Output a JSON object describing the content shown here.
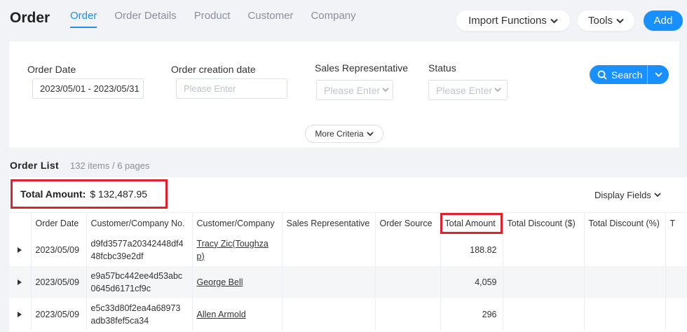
{
  "header": {
    "title": "Order",
    "tabs": [
      "Order",
      "Order Details",
      "Product",
      "Customer",
      "Company"
    ],
    "import_label": "Import Functions",
    "tools_label": "Tools",
    "add_label": "Add"
  },
  "filters": {
    "order_date_label": "Order Date",
    "order_date_value": "2023/05/01 - 2023/05/31",
    "creation_date_label": "Order creation date",
    "creation_date_placeholder": "Please Enter",
    "sales_rep_label": "Sales Representative",
    "sales_rep_placeholder": "Please Enter",
    "status_label": "Status",
    "status_placeholder": "Please Enter",
    "search_label": "Search",
    "more_label": "More Criteria"
  },
  "list": {
    "title": "Order List",
    "count": "132 items / 6 pages",
    "total_label": "Total Amount:",
    "total_value": "$ 132,487.95",
    "display_fields_label": "Display Fields",
    "columns": [
      "Order Date",
      "Customer/Company No.",
      "Customer/Company",
      "Sales Representative",
      "Order Source",
      "Total Amount",
      "Total Discount ($)",
      "Total Discount (%)",
      "T"
    ],
    "rows": [
      {
        "date": "2023/05/09",
        "no_line1": "d9fd3577a20342448df4",
        "no_line2": "48fcbc39e2df",
        "customer_line1": "Tracy Zic(Toughza",
        "customer_line2": "p)",
        "total": "188.82"
      },
      {
        "date": "2023/05/09",
        "no_line1": "e9a57bc442ee4d53abc",
        "no_line2": "0645d6171cf9c",
        "customer_line1": "George Bell",
        "customer_line2": "",
        "total": "4,059"
      },
      {
        "date": "2023/05/09",
        "no_line1": "e5c33d80f2ea4a68973",
        "no_line2": "adb38fef5ca34",
        "customer_line1": "Allen Armold",
        "customer_line2": "",
        "total": "296"
      }
    ]
  },
  "colors": {
    "accent": "#1890ff",
    "highlight": "#e0202a"
  }
}
